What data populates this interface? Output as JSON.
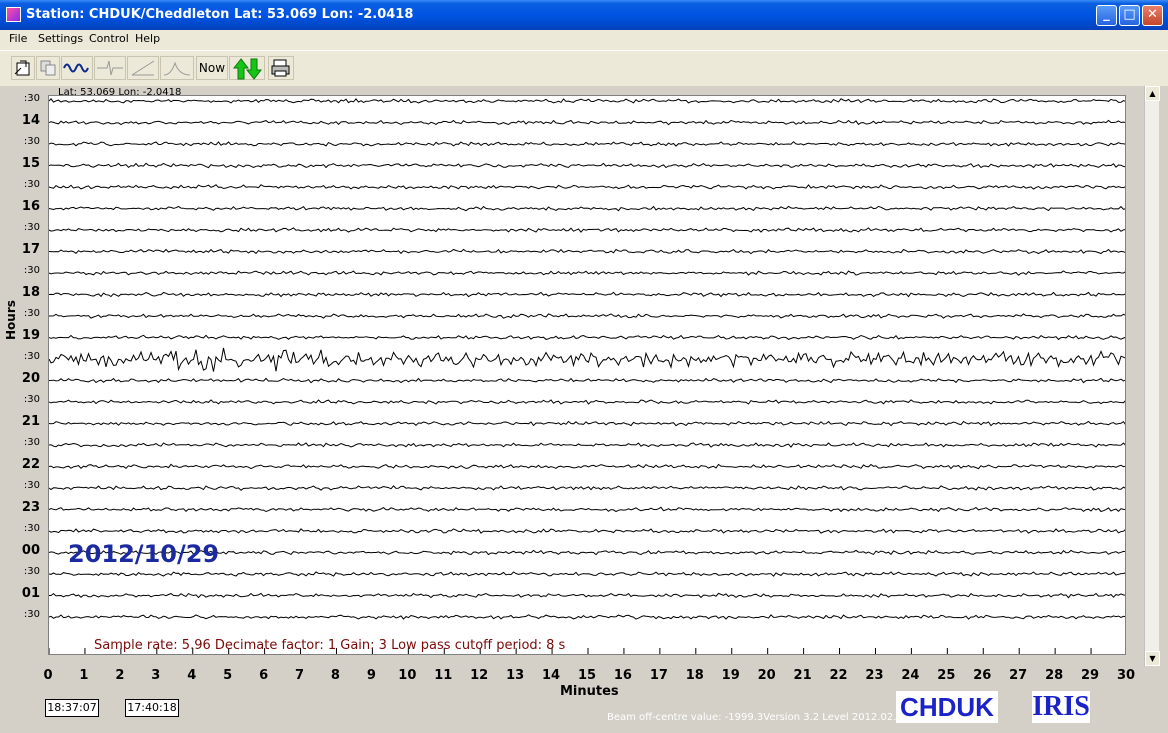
{
  "window": {
    "title": "Station: CHDUK/Cheddleton Lat: 53.069 Lon: -2.0418",
    "minimize": "_",
    "maximize": "□",
    "close": "✕"
  },
  "menu": [
    "File",
    "Settings",
    "Control",
    "Help"
  ],
  "toolbar": {
    "buttons": [
      "open-icon",
      "copy-icon",
      "waveform-icon",
      "spike-icon",
      "ramp-icon",
      "bell-curve-icon",
      "now-button",
      "scroll-arrows-icon",
      "print-icon"
    ],
    "now_label": "Now"
  },
  "header": {
    "latlon": "Lat: 53.069 Lon: -2.0418"
  },
  "y_axis": {
    "label": "Hours",
    "rows": [
      ":30",
      "14",
      ":30",
      "15",
      ":30",
      "16",
      ":30",
      "17",
      ":30",
      "18",
      ":30",
      "19",
      ":30",
      "20",
      ":30",
      "21",
      ":30",
      "22",
      ":30",
      "23",
      ":30",
      "00",
      ":30",
      "01",
      ":30"
    ]
  },
  "x_axis": {
    "label": "Minutes",
    "ticks": [
      "0",
      "1",
      "2",
      "3",
      "4",
      "5",
      "6",
      "7",
      "8",
      "9",
      "10",
      "11",
      "12",
      "13",
      "14",
      "15",
      "16",
      "17",
      "18",
      "19",
      "20",
      "21",
      "22",
      "23",
      "24",
      "25",
      "26",
      "27",
      "28",
      "29",
      "30"
    ]
  },
  "date_overlay": "2012/10/29",
  "info": "Sample rate: 5.96  Decimate factor: 1  Gain: 3  Low pass cutoff period: 8 s",
  "times": {
    "start": "18:37:07",
    "end": "17:40:18"
  },
  "status": "Beam off-centre value: -1999.3Version 3.2 Level 2012.02.11",
  "logos": {
    "station": "CHDUK",
    "network": "IRIS"
  },
  "colors": {
    "trace": "#000000",
    "date": "#1c2aa0",
    "info": "#7a0a0a",
    "logo": "#1a22c8"
  }
}
